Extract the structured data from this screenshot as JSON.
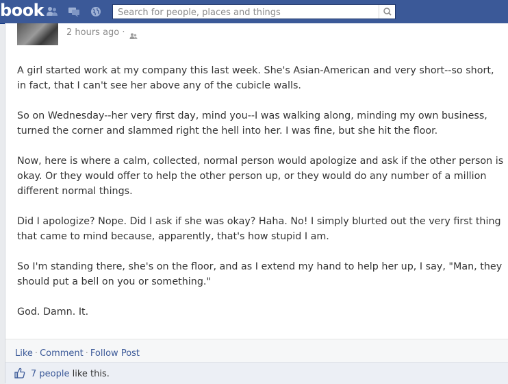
{
  "header": {
    "logo_text": "book",
    "search_placeholder": "Search for people, places and things",
    "icons": [
      "friend-requests-icon",
      "messages-icon",
      "notifications-icon",
      "search-icon"
    ]
  },
  "post": {
    "timestamp": "2 hours ago",
    "separator": "·",
    "paragraphs": [
      "A girl started work at my company this last week. She's Asian-American and very short--so short, in fact, that I can't see her above any of the cubicle walls.",
      "So on Wednesday--her very first day, mind you--I was walking along, minding my own business, turned the corner and slammed right the hell into her. I was fine, but she hit the floor.",
      "Now, here is where a calm, collected, normal person would apologize and ask if the other person is okay. Or they would offer to help the other person up, or they would do any number of a million different normal things.",
      "Did I apologize? Nope. Did I ask if she was okay? Haha. No! I simply blurted out the very first thing that came to mind because, apparently, that's how stupid I am.",
      "So I'm standing there, she's on the floor, and as I extend my hand to help her up, I say, \"Man, they should put a bell on you or something.\"",
      "God. Damn. It."
    ]
  },
  "actions": {
    "like": "Like",
    "comment": "Comment",
    "follow": "Follow Post",
    "separator": "·"
  },
  "likes": {
    "count_link": "7 people",
    "suffix": " like this."
  },
  "colors": {
    "brand_blue": "#3b5998",
    "link_blue": "#3b5998"
  }
}
